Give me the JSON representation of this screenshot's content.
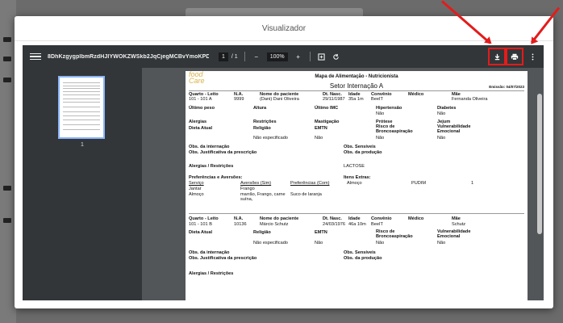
{
  "modal": {
    "title": "Visualizador"
  },
  "toolbar": {
    "filename": "8DhKzgygpIbmRzdHJIYWOKZWSkb2JqCjegMCBvYmoKPDxvVH...",
    "page_current": "1",
    "page_total": "/ 1",
    "zoom_out": "−",
    "zoom": "100%",
    "zoom_in": "+"
  },
  "thumbnail": {
    "page_number": "1"
  },
  "document": {
    "logo_top": "food",
    "logo_bottom": "Care",
    "title": "Mapa de Alimentação - Nutricionista",
    "sector": "Setor Internação A",
    "date": "Emissão: 04/07/2023",
    "headers": [
      "Quarto - Leito",
      "N.A.",
      "Nome do paciente",
      "Dt. Nasc.",
      "Idade",
      "Convênio",
      "Médico",
      "Mãe"
    ],
    "patient1": {
      "row": [
        "101 - 101 A",
        "9999",
        "(Dani) Dani Oliveira",
        "29/11/1987",
        "35a 1m",
        "BeeIT",
        "",
        "Fernanda Oliveira"
      ],
      "l1": [
        "Último peso",
        "Altura",
        "Último IMC",
        "Hipertensão",
        "Diabetes"
      ],
      "l1v": [
        "Não",
        "Não"
      ],
      "l2": [
        "Alergias",
        "Restrições",
        "Mastigação",
        "Prótese",
        "Jejum"
      ],
      "l3": [
        "Dieta Atual",
        "Religião",
        "EMTN",
        "Risco de Broncoaspiração",
        "Vulnerabilidade Emocional"
      ],
      "l3v": [
        "Não especificado",
        "Não",
        "Não",
        "Não"
      ],
      "obs_internacao": "Obs. da internação",
      "obs_sensiveis": "Obs. Sensíveis",
      "obs_justificativa": "Obs. Justificativa da prescrição",
      "obs_producao": "Obs. da produção",
      "alergias_label": "Alergias / Restrições",
      "alergias_value": "LACTOSE",
      "pref_label": "Preferências e Aversões:",
      "itens_label": "Itens Extras:",
      "pref_cols": [
        "Serviço",
        "Aversões (Sim)",
        "Preferências (Com)"
      ],
      "pref_rows": [
        [
          "Jantar",
          "Frango",
          ""
        ],
        [
          "Almoço",
          "marrão, Frango, carne suína,",
          "Suco de laranja"
        ]
      ],
      "extra": [
        "Almoço",
        "PUDIM",
        "1"
      ]
    },
    "patient2": {
      "row": [
        "101 - 101 B",
        "10136",
        "Márcio Schutz",
        "24/03/1976",
        "46a 10m",
        "BeeIT",
        "",
        "Schutz"
      ],
      "l3": [
        "Dieta Atual",
        "Religião",
        "EMTN",
        "Risco de Broncoaspiração",
        "Vulnerabilidade Emocional"
      ],
      "l3v": [
        "Não especificado",
        "Não",
        "Não",
        "Não"
      ],
      "obs_internacao": "Obs. da internação",
      "obs_sensiveis": "Obs. Sensíveis",
      "obs_justificativa": "Obs. Justificativa da prescrição",
      "obs_producao": "Obs. da produção",
      "alergias_label": "Alergias / Restrições"
    }
  },
  "colors": {
    "annotation": "#e41b1b",
    "toolbar": "#323639"
  }
}
